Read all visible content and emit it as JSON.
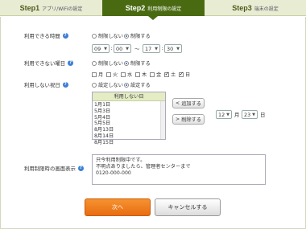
{
  "steps": [
    {
      "num": "Step1",
      "label": "アプリ/WiFiの設定"
    },
    {
      "num": "Step2",
      "label": "利用制限の設定"
    },
    {
      "num": "Step3",
      "label": "端末の設定"
    }
  ],
  "usable_time": {
    "label": "利用できる時間",
    "opt_none": "制限しない",
    "opt_limit": "制限する",
    "selected": "制限する",
    "start_hour": "09",
    "start_min": "00",
    "tilde": "〜",
    "end_hour": "17",
    "end_min": "30",
    "colon": ":"
  },
  "unusable_days": {
    "label": "利用できない曜日",
    "opt_none": "制限しない",
    "opt_limit": "制限する",
    "selected": "制限する",
    "days": [
      {
        "label": "月",
        "checked": false
      },
      {
        "label": "火",
        "checked": false
      },
      {
        "label": "水",
        "checked": false
      },
      {
        "label": "木",
        "checked": false
      },
      {
        "label": "金",
        "checked": false
      },
      {
        "label": "土",
        "checked": true
      },
      {
        "label": "日",
        "checked": true
      }
    ]
  },
  "holidays": {
    "label": "利用しない祝日",
    "opt_none": "設定しない",
    "opt_set": "設定する",
    "selected": "設定する",
    "list_header": "利用しない日",
    "dates": [
      "1月1日",
      "5月3日",
      "5月4日",
      "5月5日",
      "8月13日",
      "8月14日",
      "8月15日"
    ],
    "add_label": "追加する",
    "delete_label": "削除する",
    "month_value": "12",
    "month_unit": "月",
    "day_value": "23",
    "day_unit": "日"
  },
  "restriction_screen": {
    "label": "利用制限時の画面表示",
    "message_lines": [
      "只今利用制限中です。",
      "不明点ありましたら、管理者センターまで",
      "0120-000-000"
    ]
  },
  "buttons": {
    "next": "次へ",
    "cancel": "キャンセルする"
  },
  "colors": {
    "active_step": "#4a6a12",
    "next_button": "#f08426",
    "help_icon": "#3d7fd6"
  }
}
